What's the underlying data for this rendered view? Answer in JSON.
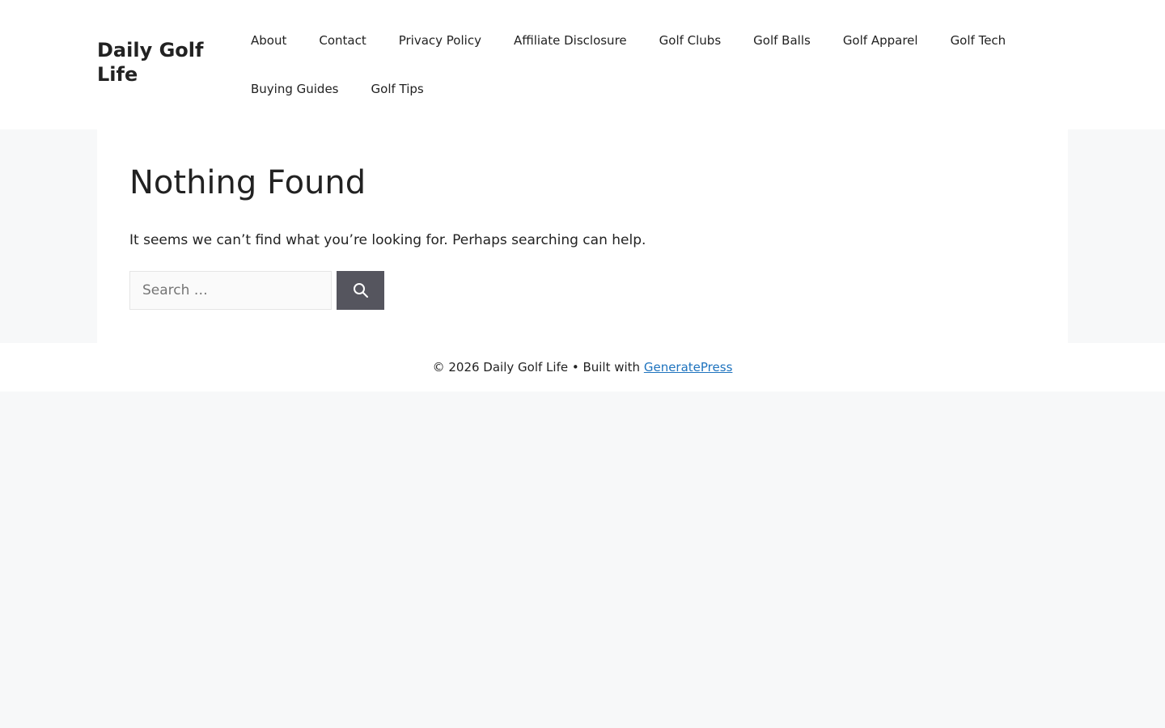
{
  "header": {
    "site_title": "Daily Golf Life",
    "nav": [
      {
        "label": "About"
      },
      {
        "label": "Contact"
      },
      {
        "label": "Privacy Policy"
      },
      {
        "label": "Affiliate Disclosure"
      },
      {
        "label": "Golf Clubs"
      },
      {
        "label": "Golf Balls"
      },
      {
        "label": "Golf Apparel"
      },
      {
        "label": "Golf Tech"
      },
      {
        "label": "Buying Guides"
      },
      {
        "label": "Golf Tips"
      }
    ]
  },
  "main": {
    "title": "Nothing Found",
    "message": "It seems we can’t find what you’re looking for. Perhaps searching can help.",
    "search": {
      "placeholder": "Search …",
      "value": "",
      "button_icon": "search-icon"
    }
  },
  "footer": {
    "copyright": "© 2026 Daily Golf Life • Built with ",
    "link_text": "GeneratePress"
  },
  "colors": {
    "page_background": "#f7f8f9",
    "search_button": "#55555e",
    "link": "#1e73be"
  }
}
